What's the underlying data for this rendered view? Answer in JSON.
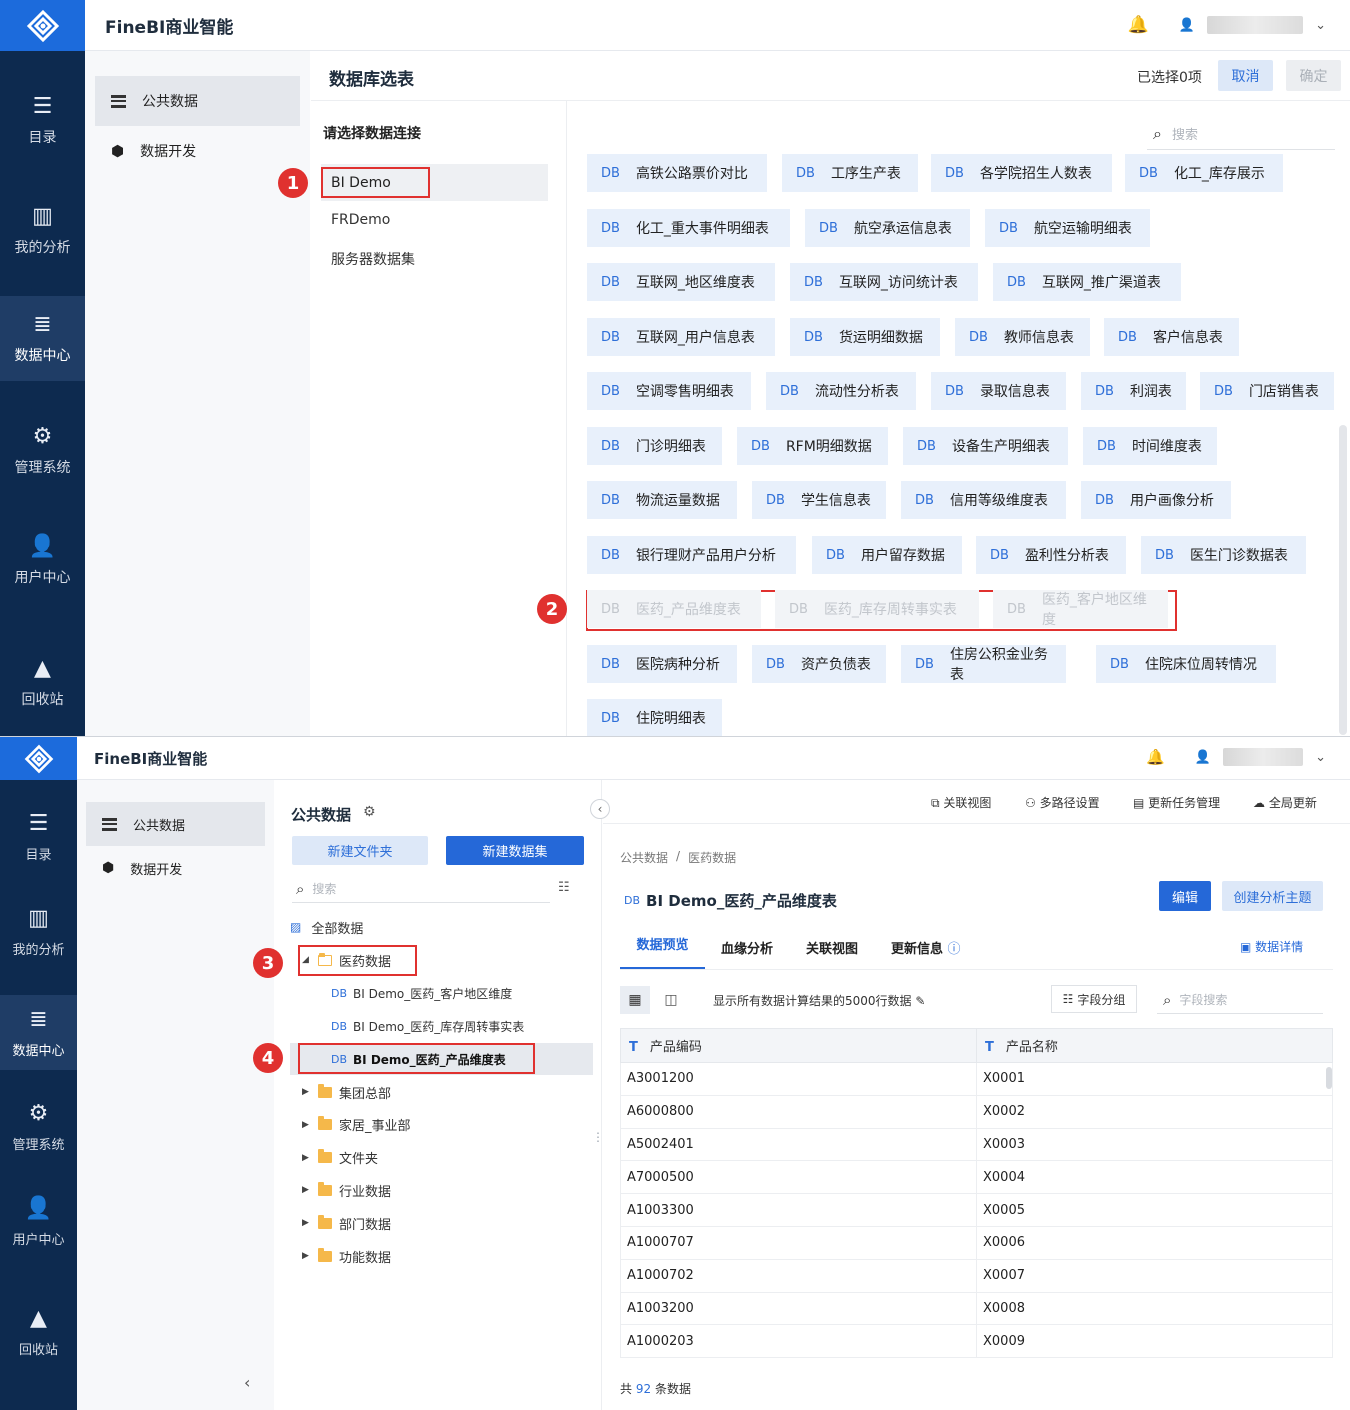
{
  "app": {
    "brand": "FineBI商业智能"
  },
  "nav": {
    "items": [
      {
        "label": "目录",
        "icon": "catalog-icon"
      },
      {
        "label": "我的分析",
        "icon": "analysis-icon"
      },
      {
        "label": "数据中心",
        "icon": "data-center-icon"
      },
      {
        "label": "管理系统",
        "icon": "management-icon"
      },
      {
        "label": "用户中心",
        "icon": "user-center-icon"
      },
      {
        "label": "回收站",
        "icon": "recycle-icon"
      }
    ]
  },
  "side": {
    "public_data": "公共数据",
    "data_dev": "数据开发"
  },
  "top": {
    "title": "数据库选表",
    "selected": "已选择0项",
    "cancel": "取消",
    "confirm": "确定",
    "conn_title": "请选择数据连接",
    "connections": [
      "BI Demo",
      "FRDemo",
      "服务器数据集"
    ],
    "search_placeholder": "搜索",
    "db_label": "DB",
    "tables": [
      [
        "高铁公路票价对比",
        "工序生产表",
        "各学院招生人数表",
        "化工_库存展示"
      ],
      [
        "化工_重大事件明细表",
        "航空承运信息表",
        "航空运输明细表"
      ],
      [
        "互联网_地区维度表",
        "互联网_访问统计表",
        "互联网_推广渠道表"
      ],
      [
        "互联网_用户信息表",
        "货运明细数据",
        "教师信息表",
        "客户信息表"
      ],
      [
        "空调零售明细表",
        "流动性分析表",
        "录取信息表",
        "利润表",
        "门店销售表"
      ],
      [
        "门诊明细表",
        "RFM明细数据",
        "设备生产明细表",
        "时间维度表"
      ],
      [
        "物流运量数据",
        "学生信息表",
        "信用等级维度表",
        "用户画像分析"
      ],
      [
        "银行理财产品用户分析",
        "用户留存数据",
        "盈利性分析表",
        "医生门诊数据表"
      ],
      [
        "医药_产品维度表",
        "医药_库存周转事实表",
        "医药_客户地区维度"
      ],
      [
        "医院病种分析",
        "资产负债表",
        "住房公积金业务表",
        "住院床位周转情况"
      ],
      [
        "住院明细表"
      ]
    ],
    "badges": [
      "1",
      "2"
    ]
  },
  "bottom": {
    "panel_title": "公共数据",
    "new_folder": "新建文件夹",
    "new_dataset": "新建数据集",
    "search_placeholder": "搜索",
    "all_data": "全部数据",
    "tree_open_folder": "医药数据",
    "tree_children": [
      "BI Demo_医药_客户地区维度",
      "BI Demo_医药_库存周转事实表",
      "BI Demo_医药_产品维度表"
    ],
    "tree_folders": [
      "集团总部",
      "家居_事业部",
      "文件夹",
      "行业数据",
      "部门数据",
      "功能数据"
    ],
    "db_label": "DB",
    "toolbar": [
      "关联视图",
      "多路径设置",
      "更新任务管理",
      "全局更新"
    ],
    "breadcrumb": [
      "公共数据",
      "/",
      "医药数据"
    ],
    "dataset_title": "BI Demo_医药_产品维度表",
    "edit": "编辑",
    "create_topic": "创建分析主题",
    "tabs": [
      "数据预览",
      "血缘分析",
      "关联视图",
      "更新信息"
    ],
    "data_detail": "数据详情",
    "preview_note": "显示所有数据计算结果的5000行数据",
    "field_group": "字段分组",
    "field_search": "字段搜索",
    "columns": [
      "产品编码",
      "产品名称"
    ],
    "col_type": "T",
    "rows": [
      [
        "A3001200",
        "X0001"
      ],
      [
        "A6000800",
        "X0002"
      ],
      [
        "A5002401",
        "X0003"
      ],
      [
        "A7000500",
        "X0004"
      ],
      [
        "A1003300",
        "X0005"
      ],
      [
        "A1000707",
        "X0006"
      ],
      [
        "A1000702",
        "X0007"
      ],
      [
        "A1003200",
        "X0008"
      ],
      [
        "A1000203",
        "X0009"
      ]
    ],
    "total_prefix": "共",
    "total_count": "92",
    "total_suffix": "条数据",
    "badges": [
      "3",
      "4"
    ]
  }
}
